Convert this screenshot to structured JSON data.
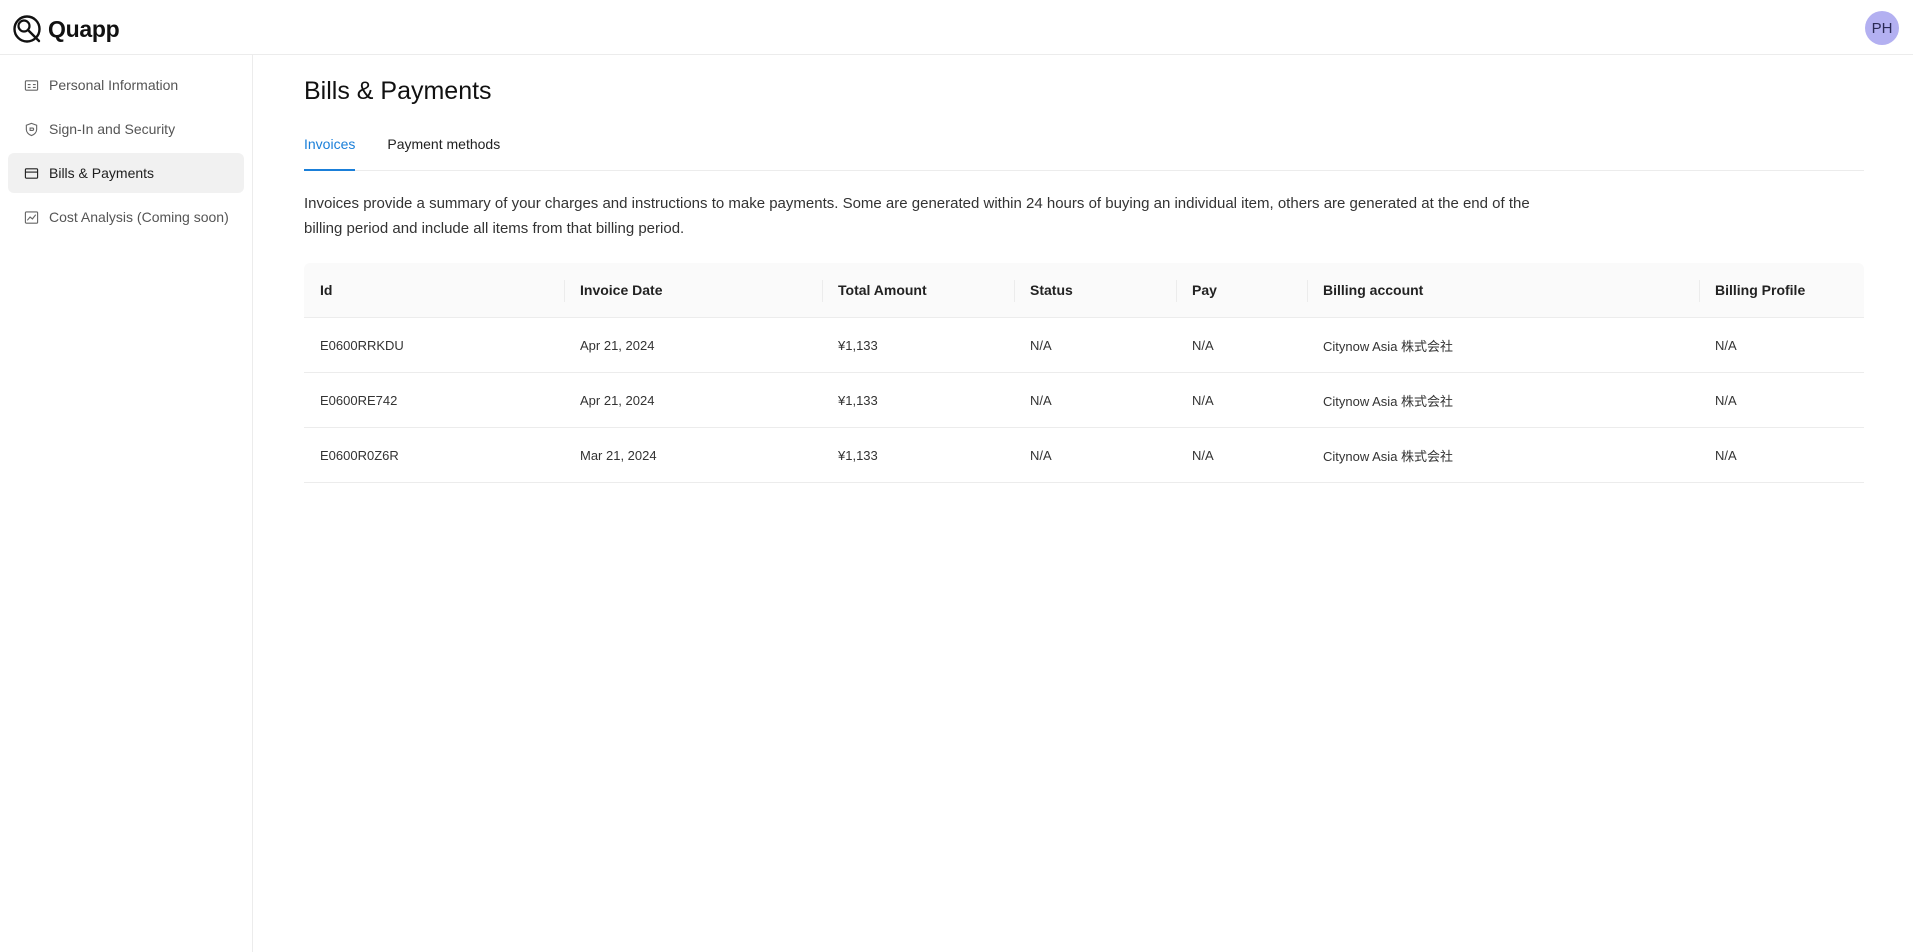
{
  "brand": {
    "name": "Quapp"
  },
  "user": {
    "initials": "PH"
  },
  "sidebar": {
    "items": [
      {
        "label": "Personal Information",
        "icon": "id-card-icon",
        "active": false
      },
      {
        "label": "Sign-In and Security",
        "icon": "shield-icon",
        "active": false
      },
      {
        "label": "Bills & Payments",
        "icon": "credit-card-icon",
        "active": true
      },
      {
        "label": "Cost Analysis (Coming soon)",
        "icon": "line-chart-icon",
        "active": false
      }
    ]
  },
  "main": {
    "title": "Bills & Payments",
    "tabs": [
      {
        "label": "Invoices",
        "active": true
      },
      {
        "label": "Payment methods",
        "active": false
      }
    ],
    "description": "Invoices provide a summary of your charges and instructions to make payments. Some are generated within 24 hours of buying an individual item, others are generated at the end of the billing period and include all items from that billing period.",
    "table": {
      "columns": [
        "Id",
        "Invoice Date",
        "Total Amount",
        "Status",
        "Pay",
        "Billing account",
        "Billing Profile"
      ],
      "rows": [
        [
          "E0600RRKDU",
          "Apr 21, 2024",
          "¥1,133",
          "N/A",
          "N/A",
          "Citynow Asia 株式会社",
          "N/A"
        ],
        [
          "E0600RE742",
          "Apr 21, 2024",
          "¥1,133",
          "N/A",
          "N/A",
          "Citynow Asia 株式会社",
          "N/A"
        ],
        [
          "E0600R0Z6R",
          "Mar 21, 2024",
          "¥1,133",
          "N/A",
          "N/A",
          "Citynow Asia 株式会社",
          "N/A"
        ]
      ]
    }
  },
  "colors": {
    "accent": "#1a7fd9",
    "avatar_bg": "#b3b0f1",
    "active_item_bg": "#f1f1f1"
  }
}
